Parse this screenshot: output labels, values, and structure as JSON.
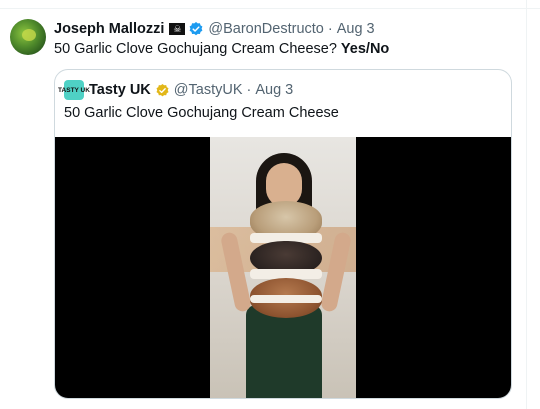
{
  "tweet": {
    "author_name": "Joseph Mallozzi",
    "flag_glyph": "☠",
    "handle": "@BaronDestructo",
    "separator": "·",
    "time": "Aug 3",
    "text_main": "50 Garlic Clove Gochujang Cream Cheese? ",
    "text_bold": "Yes/No"
  },
  "quoted": {
    "avatar_text": "TASTY UK",
    "author_name": "Tasty UK",
    "handle": "@TastyUK",
    "separator": "·",
    "time": "Aug 3",
    "text": "50 Garlic Clove Gochujang Cream Cheese"
  },
  "colors": {
    "verified_blue": "#1d9bf0",
    "gold_badge": "#e2b719",
    "secondary_text": "#536471",
    "border": "#cfd9de"
  },
  "icons": [
    "avatar",
    "pirate-flag-icon",
    "verified-badge-icon",
    "gold-verified-badge-icon"
  ]
}
